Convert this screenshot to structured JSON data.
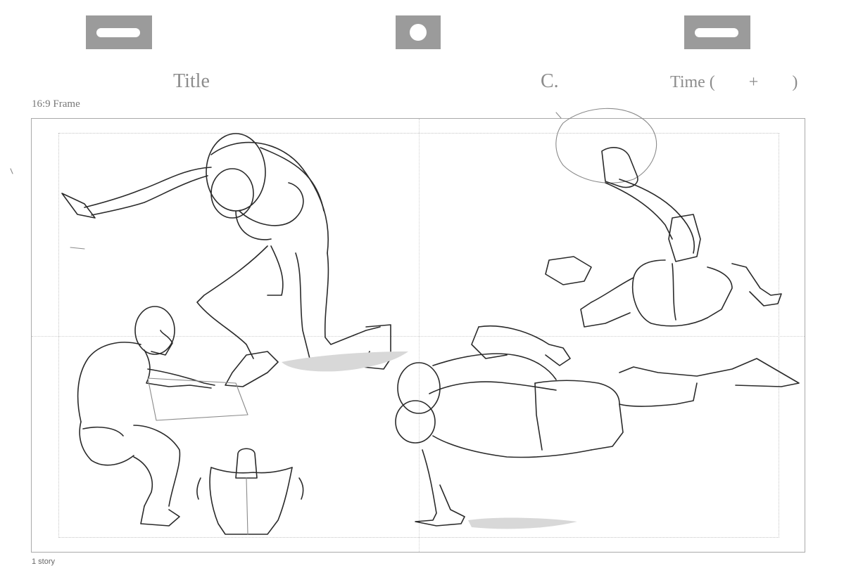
{
  "header": {
    "title_label": "Title",
    "cut_label": "C.",
    "time_label": "Time (        +        )"
  },
  "frame": {
    "label": "16:9 Frame",
    "aspect": "16:9"
  },
  "footer": {
    "story_label": "1 story"
  },
  "sketch_figures": [
    "kneeling-figure",
    "crouching-figure",
    "top-down-figure",
    "leaping-figure",
    "breakdance-figure"
  ]
}
